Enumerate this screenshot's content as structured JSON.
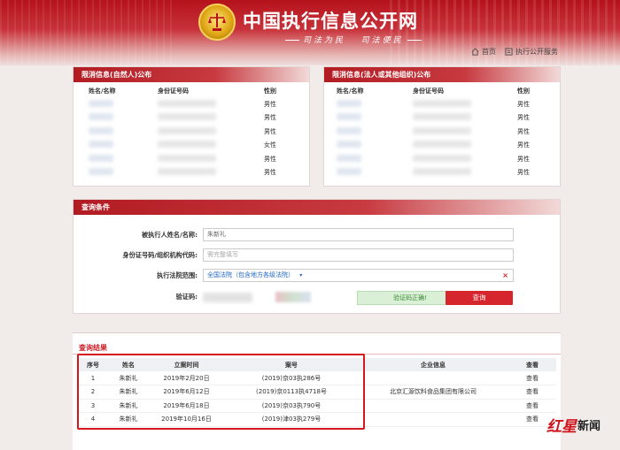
{
  "header": {
    "site_title": "中国执行信息公开网",
    "slogan_left": "司法为民",
    "slogan_right": "司法便民",
    "nav_home": "首页",
    "nav_exec_service": "执行公开服务"
  },
  "left_panel": {
    "title": "限消信息(自然人)公布",
    "columns": [
      "姓名/名称",
      "身份证号码",
      "性别"
    ],
    "rows": [
      {
        "gender": "男性"
      },
      {
        "gender": "男性"
      },
      {
        "gender": "男性"
      },
      {
        "gender": "女性"
      },
      {
        "gender": "男性"
      },
      {
        "gender": "男性"
      }
    ]
  },
  "right_panel": {
    "title": "限消信息(法人或其他组织)公布",
    "columns": [
      "姓名/名称",
      "身份证号码",
      "性别"
    ],
    "rows": [
      {
        "gender": "男性"
      },
      {
        "gender": "男性"
      },
      {
        "gender": "男性"
      },
      {
        "gender": "男性"
      },
      {
        "gender": "男性"
      },
      {
        "gender": "男性"
      }
    ]
  },
  "query": {
    "title": "查询条件",
    "name_label": "被执行人姓名/名称:",
    "name_value": "朱新礼",
    "id_label": "身份证号码/组织机构代码:",
    "id_placeholder": "需完整填写",
    "court_label": "执行法院范围:",
    "court_value": "全国法院（包含地方各级法院）",
    "code_label": "验证码:",
    "verify_ok": "验证码正确!",
    "search_button": "查询"
  },
  "results": {
    "title": "查询结果",
    "columns": [
      "序号",
      "姓名",
      "立案时间",
      "案号",
      "企业信息",
      "查看"
    ],
    "rows": [
      {
        "no": "1",
        "name": "朱新礼",
        "date": "2019年2月20日",
        "case": "(2019)京03执286号",
        "company": "",
        "view": "查看"
      },
      {
        "no": "2",
        "name": "朱新礼",
        "date": "2019年6月12日",
        "case": "(2019)京0113执4718号",
        "company": "北京汇源饮料食品集团有限公司",
        "view": "查看"
      },
      {
        "no": "3",
        "name": "朱新礼",
        "date": "2019年6月18日",
        "case": "(2019)京03执790号",
        "company": "",
        "view": "查看"
      },
      {
        "no": "4",
        "name": "朱新礼",
        "date": "2019年10月16日",
        "case": "(2019)津03执279号",
        "company": "",
        "view": "查看"
      }
    ]
  },
  "watermark": {
    "red": "红星",
    "black": "新闻"
  },
  "colors": {
    "brand_red": "#c8262c",
    "link_blue": "#1f67c6",
    "ok_green": "#3c8a35"
  }
}
